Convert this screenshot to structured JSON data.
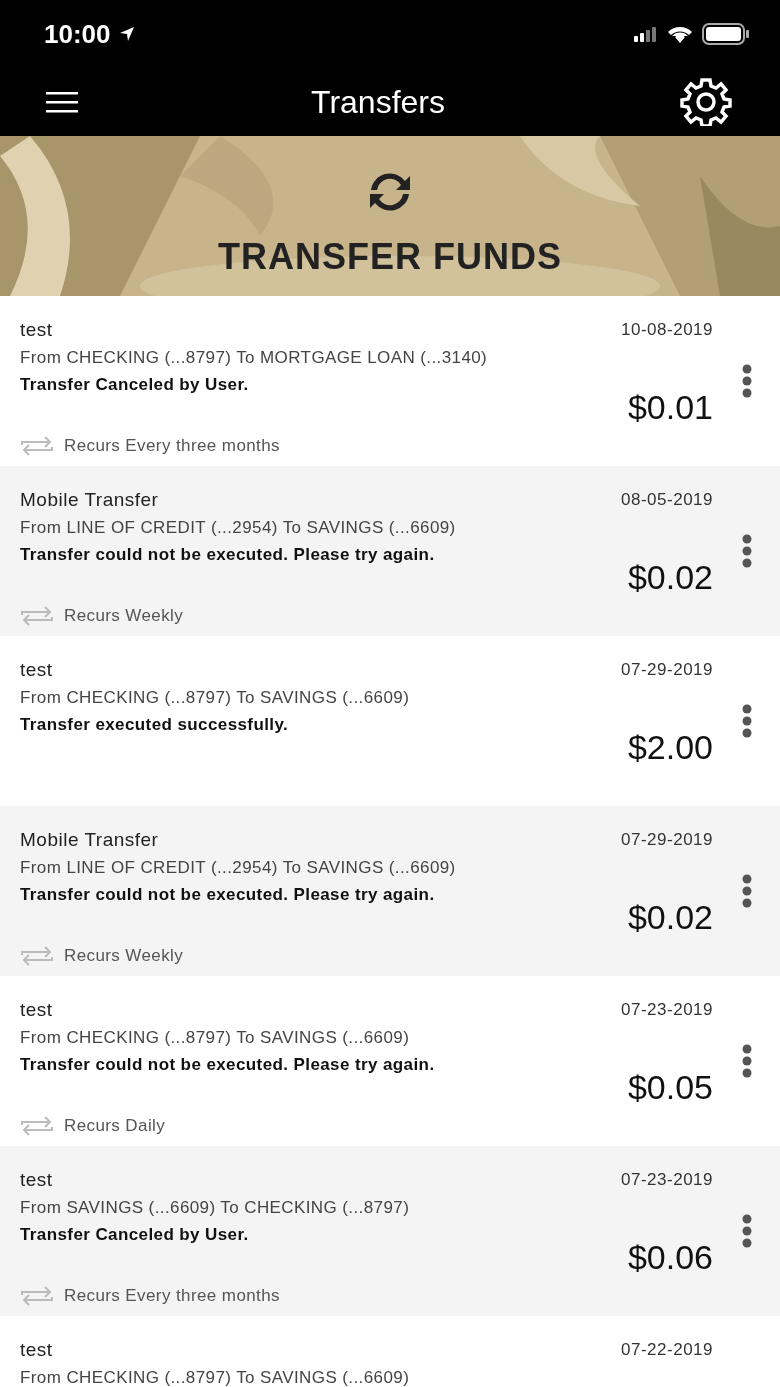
{
  "status_bar": {
    "time": "10:00"
  },
  "header": {
    "title": "Transfers"
  },
  "banner": {
    "title": "TRANSFER FUNDS"
  },
  "transfers": [
    {
      "title": "test",
      "date": "10-08-2019",
      "accounts": "From CHECKING (...8797) To MORTGAGE LOAN (...3140)",
      "status": "Transfer Canceled by User.",
      "amount": "$0.01",
      "recurs": "Recurs Every three months"
    },
    {
      "title": "Mobile Transfer",
      "date": "08-05-2019",
      "accounts": "From LINE OF CREDIT (...2954) To SAVINGS (...6609)",
      "status": "Transfer could not be executed. Please try again.",
      "amount": "$0.02",
      "recurs": "Recurs Weekly"
    },
    {
      "title": "test",
      "date": "07-29-2019",
      "accounts": "From CHECKING (...8797) To SAVINGS (...6609)",
      "status": "Transfer executed successfully.",
      "amount": "$2.00"
    },
    {
      "title": "Mobile Transfer",
      "date": "07-29-2019",
      "accounts": "From LINE OF CREDIT (...2954) To SAVINGS (...6609)",
      "status": "Transfer could not be executed. Please try again.",
      "amount": "$0.02",
      "recurs": "Recurs Weekly"
    },
    {
      "title": "test",
      "date": "07-23-2019",
      "accounts": "From CHECKING (...8797) To SAVINGS (...6609)",
      "status": "Transfer could not be executed. Please try again.",
      "amount": "$0.05",
      "recurs": "Recurs Daily"
    },
    {
      "title": "test",
      "date": "07-23-2019",
      "accounts": "From SAVINGS (...6609) To CHECKING (...8797)",
      "status": "Transfer Canceled by User.",
      "amount": "$0.06",
      "recurs": "Recurs Every three months"
    },
    {
      "title": "test",
      "date": "07-22-2019",
      "accounts": "From CHECKING (...8797) To SAVINGS (...6609)"
    }
  ]
}
